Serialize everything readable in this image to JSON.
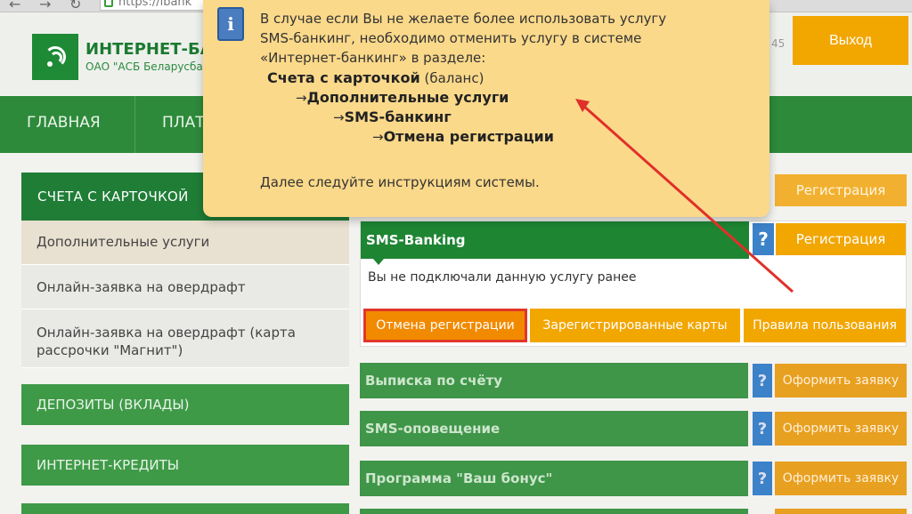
{
  "browser": {
    "url": "https://ibank"
  },
  "header": {
    "logo_title": "ИНТЕРНЕТ-БАНКИНГ",
    "logo_sub": "ОАО \"АСБ Беларусбанк\"",
    "number_fragment": "45",
    "logout_label": "Выход"
  },
  "mainnav": {
    "items": [
      {
        "label": "ГЛАВНАЯ"
      },
      {
        "label": "ПЛАТЕЖИ"
      }
    ]
  },
  "sidebar": {
    "head": "СЧЕТА С КАРТОЧКОЙ",
    "items": [
      {
        "label": "Дополнительные услуги"
      },
      {
        "label": "Онлайн-заявка на овердрафт"
      },
      {
        "label": "Онлайн-заявка на овердрафт (карта рассрочки \"Магнит\")"
      }
    ],
    "sections": [
      {
        "label": "ДЕПОЗИТЫ (ВКЛАДЫ)"
      },
      {
        "label": "ИНТЕРНЕТ-КРЕДИТЫ"
      }
    ]
  },
  "sms_panel": {
    "title": "SMS-Banking",
    "help": "?",
    "register_label": "Регистрация",
    "status_text": "Вы не подключали данную услугу ранее",
    "buttons": {
      "cancel": "Отмена регистрации",
      "cards": "Зарегистрированные карты",
      "rules": "Правила пользования"
    }
  },
  "top_register_label": "Регистрация",
  "services": [
    {
      "title": "Выписка по счёту",
      "help": "?",
      "order": "Оформить заявку"
    },
    {
      "title": "SMS-оповещение",
      "help": "?",
      "order": "Оформить заявку"
    },
    {
      "title": "Программа \"Ваш бонус\"",
      "help": "?",
      "order": "Оформить заявку"
    }
  ],
  "tooltip": {
    "icon": "i",
    "line1": "В случае если Вы не желаете более использовать услугу",
    "line2": "SMS-банкинг, необходимо отменить услугу в системе",
    "line3": "«Интернет-банкинг» в разделе:",
    "path1_bold": "Счета с карточкой",
    "path1_rest": " (баланс)",
    "path2": "Дополнительные услуги",
    "path3": "SMS-банкинг",
    "path4": "Отмена регистрации",
    "arrow_glyph": "→",
    "footer": "Далее следуйте инструкциям системы."
  },
  "colors": {
    "green": "#1e8533",
    "orange": "#f2a600",
    "arrow_red": "#e0302a",
    "tooltip_bg": "#fbd98a"
  }
}
